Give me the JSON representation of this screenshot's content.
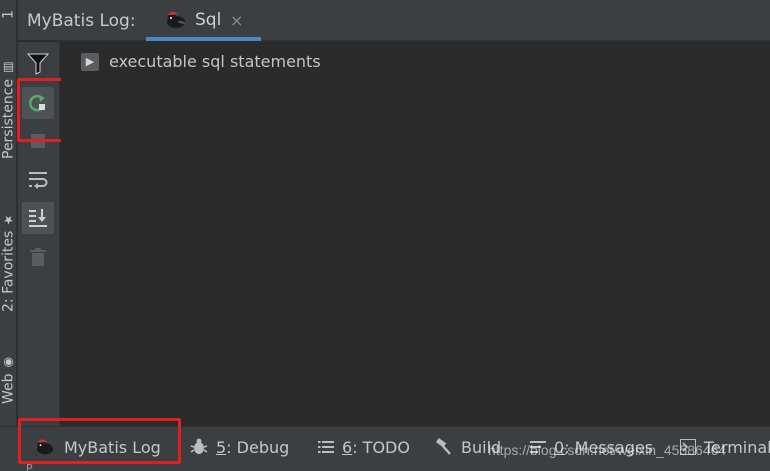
{
  "side_tabs": {
    "top_partial": "1",
    "persistence": "Persistence",
    "favorites": "2: Favorites",
    "web": "Web"
  },
  "header": {
    "tool_title": "MyBatis Log:",
    "tab_label": "Sql",
    "tab_close": "×"
  },
  "toolbar_icons": [
    "filter-icon",
    "rerun-icon",
    "stop-icon",
    "soft-wrap-icon",
    "scroll-to-end-icon",
    "clear-icon"
  ],
  "content": {
    "node_label": "executable sql statements"
  },
  "bottom_bar": {
    "mybatis_log": "MyBatis Log",
    "debug_num": "5",
    "debug_label": ": Debug",
    "todo_num": "6",
    "todo_label": ": TODO",
    "build": "Build",
    "messages_num": "0",
    "messages_label": ": Messages",
    "terminal": "Terminal"
  },
  "watermark": "https://blog.csdn.net/weixin_45586464",
  "below_partial": "P",
  "colors": {
    "accent": "#4a88c7",
    "highlight_box": "#e02020",
    "rerun_green": "#59a869",
    "panel": "#3c3f41",
    "editor": "#2b2b2b"
  }
}
